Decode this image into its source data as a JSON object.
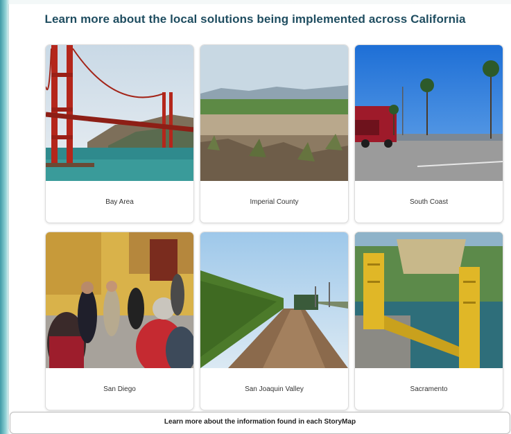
{
  "page": {
    "title": "Learn more about the local solutions being implemented across California"
  },
  "cards": [
    {
      "label": "Bay Area",
      "image_icon": "golden-gate-bridge-photo"
    },
    {
      "label": "Imperial County",
      "image_icon": "desert-farmland-photo"
    },
    {
      "label": "South Coast",
      "image_icon": "truck-palm-trees-photo"
    },
    {
      "label": "San Diego",
      "image_icon": "community-group-photo"
    },
    {
      "label": "San Joaquin Valley",
      "image_icon": "vineyard-road-photo"
    },
    {
      "label": "Sacramento",
      "image_icon": "tower-bridge-photo"
    }
  ],
  "footer": {
    "storymap_label": "Learn more about the information found in each StoryMap"
  },
  "colors": {
    "title": "#1f4d60",
    "accent_edge": "#3f9aa6"
  }
}
